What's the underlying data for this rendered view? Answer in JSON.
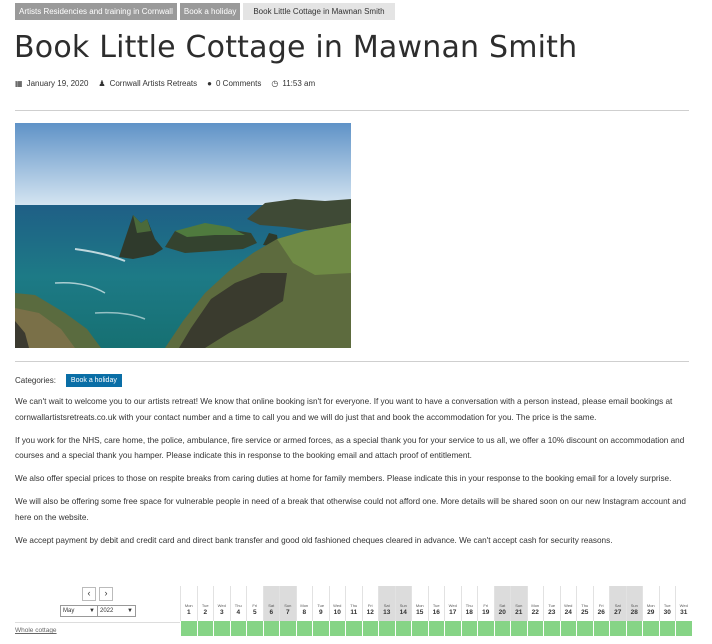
{
  "breadcrumbs": [
    "Artists Residencies and training in Cornwall",
    "Book a holiday",
    "Book Little Cottage in Mawnan Smith"
  ],
  "title": "Book Little Cottage in Mawnan Smith",
  "meta": {
    "date": "January 19, 2020",
    "author": "Cornwall Artists Retreats",
    "comments": "0 Comments",
    "time": "11:53 am",
    "date_icon": "calendar-icon",
    "author_icon": "user-icon",
    "comments_icon": "comments-icon",
    "time_icon": "clock-icon"
  },
  "categories": {
    "label": "Categories:",
    "tag": "Book a holiday",
    "tag_color": "#0a6ea6"
  },
  "paragraphs": [
    "We can't wait to welcome you to our artists retreat! We know that online booking isn't for everyone. If you want to have a conversation with a person instead, please email bookings at cornwallartistsretreats.co.uk with your contact number and a time to call you and we will do just that and book the accommodation for you. The price is the same.",
    "If you work for the NHS, care home, the police, ambulance, fire service or armed forces, as a special thank you for your service to us all, we offer a 10% discount on accommodation and courses and a special thank you hamper. Please indicate this in response to the booking email and attach proof of entitlement.",
    "We also offer special prices to those on respite breaks from caring duties at home for family members. Please indicate this in your response to the booking email for a lovely surprise.",
    "We will also be offering some free space for vulnerable people in need of a break that otherwise could not afford one. More details will be shared soon on our new Instagram account and here on the website.",
    "We accept payment by debit and credit card and direct bank transfer and good old fashioned cheques cleared in advance. We can't accept cash for security reasons."
  ],
  "calendar": {
    "prev": "‹",
    "next": "›",
    "month": "May",
    "year": "2022",
    "row_label": "Whole cottage",
    "available_color": "#86d486",
    "days": [
      {
        "dn": "Mon",
        "num": "1"
      },
      {
        "dn": "Tue",
        "num": "2"
      },
      {
        "dn": "Wed",
        "num": "3"
      },
      {
        "dn": "Thu",
        "num": "4"
      },
      {
        "dn": "Fri",
        "num": "5"
      },
      {
        "dn": "Sat",
        "num": "6"
      },
      {
        "dn": "Sun",
        "num": "7"
      },
      {
        "dn": "Mon",
        "num": "8"
      },
      {
        "dn": "Tue",
        "num": "9"
      },
      {
        "dn": "Wed",
        "num": "10"
      },
      {
        "dn": "Thu",
        "num": "11"
      },
      {
        "dn": "Fri",
        "num": "12"
      },
      {
        "dn": "Sat",
        "num": "13"
      },
      {
        "dn": "Sun",
        "num": "14"
      },
      {
        "dn": "Mon",
        "num": "15"
      },
      {
        "dn": "Tue",
        "num": "16"
      },
      {
        "dn": "Wed",
        "num": "17"
      },
      {
        "dn": "Thu",
        "num": "18"
      },
      {
        "dn": "Fri",
        "num": "19"
      },
      {
        "dn": "Sat",
        "num": "20"
      },
      {
        "dn": "Sun",
        "num": "21"
      },
      {
        "dn": "Mon",
        "num": "22"
      },
      {
        "dn": "Tue",
        "num": "23"
      },
      {
        "dn": "Wed",
        "num": "24"
      },
      {
        "dn": "Thu",
        "num": "25"
      },
      {
        "dn": "Fri",
        "num": "26"
      },
      {
        "dn": "Sat",
        "num": "27"
      },
      {
        "dn": "Sun",
        "num": "28"
      },
      {
        "dn": "Mon",
        "num": "29"
      },
      {
        "dn": "Tue",
        "num": "30"
      },
      {
        "dn": "Wed",
        "num": "31"
      }
    ]
  }
}
